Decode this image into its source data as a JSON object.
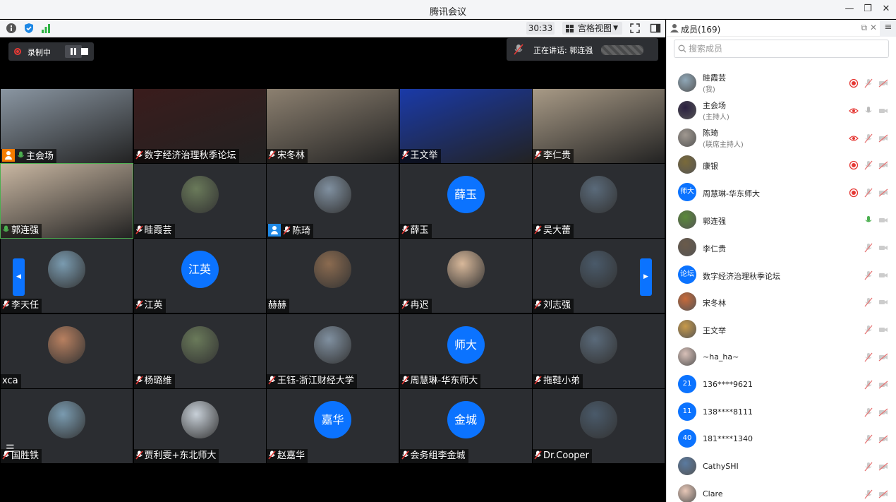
{
  "window": {
    "title": "腾讯会议"
  },
  "toolbar": {
    "timer": "30:33",
    "view_label": "宫格视图"
  },
  "recording": {
    "label": "录制中"
  },
  "speaking": {
    "label": "正在讲话: 郭连强"
  },
  "tiles": [
    {
      "name": "主会场",
      "type": "video",
      "host": true
    },
    {
      "name": "数字经济治理秋季论坛",
      "type": "video"
    },
    {
      "name": "宋冬林",
      "type": "video"
    },
    {
      "name": "王文举",
      "type": "video"
    },
    {
      "name": "李仁贵",
      "type": "video"
    },
    {
      "name": "郭连强",
      "type": "video",
      "active": true
    },
    {
      "name": "眭霞芸",
      "type": "image"
    },
    {
      "name": "陈琦",
      "type": "image",
      "cohost": true
    },
    {
      "name": "薛玉",
      "type": "text",
      "avatar_text": "薛玉"
    },
    {
      "name": "吴大蕾",
      "type": "image"
    },
    {
      "name": "李天任",
      "type": "image"
    },
    {
      "name": "江英",
      "type": "text",
      "avatar_text": "江英"
    },
    {
      "name": "赫赫",
      "type": "image",
      "nomic": true
    },
    {
      "name": "冉迟",
      "type": "image"
    },
    {
      "name": "刘志强",
      "type": "image"
    },
    {
      "name": "xca",
      "type": "image",
      "nomic": true
    },
    {
      "name": "杨璐维",
      "type": "image"
    },
    {
      "name": "王钰-浙江财经大学",
      "type": "image"
    },
    {
      "name": "周慧琳-华东师大",
      "type": "text",
      "avatar_text": "师大"
    },
    {
      "name": "拖鞋小弟",
      "type": "image"
    },
    {
      "name": "国胜铁",
      "type": "image"
    },
    {
      "name": "贾利雯+东北师大",
      "type": "image"
    },
    {
      "name": "赵嘉华",
      "type": "text",
      "avatar_text": "嘉华"
    },
    {
      "name": "会务组李金城",
      "type": "text",
      "avatar_text": "金城"
    },
    {
      "name": "Dr.Cooper",
      "type": "image"
    }
  ],
  "sidebar": {
    "title": "成员(169)",
    "search_placeholder": "搜索成员",
    "members": [
      {
        "name": "眭霞芸",
        "role": "(我)",
        "rec": true,
        "mic": "muted",
        "cam": "off"
      },
      {
        "name": "主会场",
        "role": "(主持人)",
        "rec": "eye",
        "mic": "on-gray",
        "cam": "on"
      },
      {
        "name": "陈琦",
        "role": "(联席主持人)",
        "rec": "eye",
        "mic": "muted",
        "cam": "off"
      },
      {
        "name": "康银",
        "rec": true,
        "mic": "muted",
        "cam": "off"
      },
      {
        "name": "周慧琳-华东师大",
        "avatar_text": "师大",
        "rec": true,
        "mic": "muted",
        "cam": "off"
      },
      {
        "name": "郭连强",
        "mic": "speaking",
        "cam": "on"
      },
      {
        "name": "李仁贵",
        "mic": "muted",
        "cam": "on"
      },
      {
        "name": "数字经济治理秋季论坛",
        "avatar_text": "论坛",
        "mic": "muted",
        "cam": "on"
      },
      {
        "name": "宋冬林",
        "mic": "muted",
        "cam": "on"
      },
      {
        "name": "王文举",
        "mic": "muted",
        "cam": "on"
      },
      {
        "name": "~ha_ha~",
        "mic": "muted",
        "cam": "off"
      },
      {
        "name": "136****9621",
        "avatar_text": "21",
        "mic": "muted",
        "cam": "off"
      },
      {
        "name": "138****8111",
        "avatar_text": "11",
        "mic": "muted",
        "cam": "off"
      },
      {
        "name": "181****1340",
        "avatar_text": "40",
        "mic": "muted",
        "cam": "off"
      },
      {
        "name": "CathySHI",
        "mic": "muted",
        "cam": "off"
      },
      {
        "name": "Clare",
        "mic": "muted",
        "cam": "off"
      }
    ]
  },
  "colors": {
    "accent": "#0b73ff",
    "tile_bg": "#2b2d31",
    "record_red": "#e53935",
    "speaking_green": "#4caf50"
  }
}
